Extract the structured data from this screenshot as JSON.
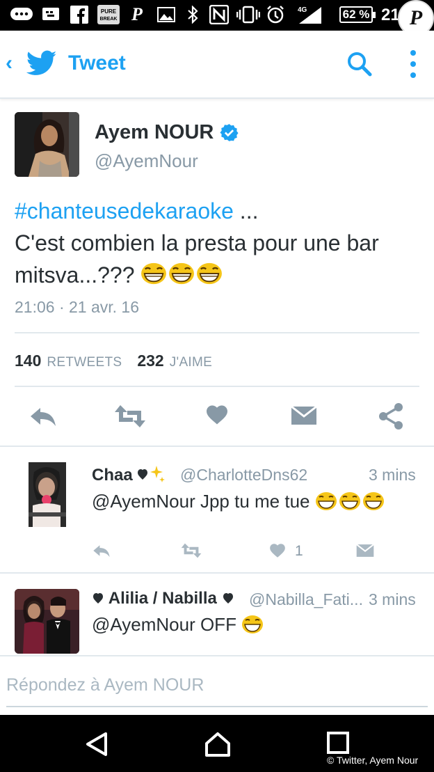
{
  "status_bar": {
    "battery": "62 %",
    "clock": "21",
    "network": "4G",
    "icons": [
      "chat-icon",
      "keyboard-icon",
      "facebook-icon",
      "purebreak-icon",
      "pinterest-icon",
      "gallery-icon",
      "bluetooth-icon",
      "nfc-icon",
      "vibrate-icon",
      "alarm-icon",
      "signal-icon"
    ],
    "purebreak_label": "PURE BREAK",
    "logo_letter": "P"
  },
  "app_bar": {
    "back": "‹",
    "title": "Tweet"
  },
  "tweet": {
    "author_name": "Ayem NOUR",
    "author_handle": "@AyemNour",
    "hashtag": "#chanteusedekaraoke",
    "text_rest": " ...",
    "text_line2": "C'est combien la presta pour une bar mitsva...???",
    "emoji_count": 3,
    "timestamp": "21:06 · 21 avr. 16",
    "retweets_count": "140",
    "retweets_label": "RETWEETS",
    "likes_count": "232",
    "likes_label": "J'AIME"
  },
  "replies": [
    {
      "name": "Chaa",
      "handle": "@CharlotteDns62",
      "time": "3 mins",
      "text": "@AyemNour Jpp tu me tue",
      "emoji_count": 3,
      "like_count": "1"
    },
    {
      "name": "Alilia / Nabilla",
      "handle": "@Nabilla_Fati...",
      "time": "3 mins",
      "text": "@AyemNour OFF",
      "emoji_count": 1
    }
  ],
  "compose": {
    "placeholder": "Répondez à Ayem NOUR"
  },
  "credit": "© Twitter, Ayem Nour",
  "colors": {
    "accent": "#1da1f2",
    "text": "#292f33",
    "muted": "#8899a6",
    "action_icon": "#8899a6"
  }
}
